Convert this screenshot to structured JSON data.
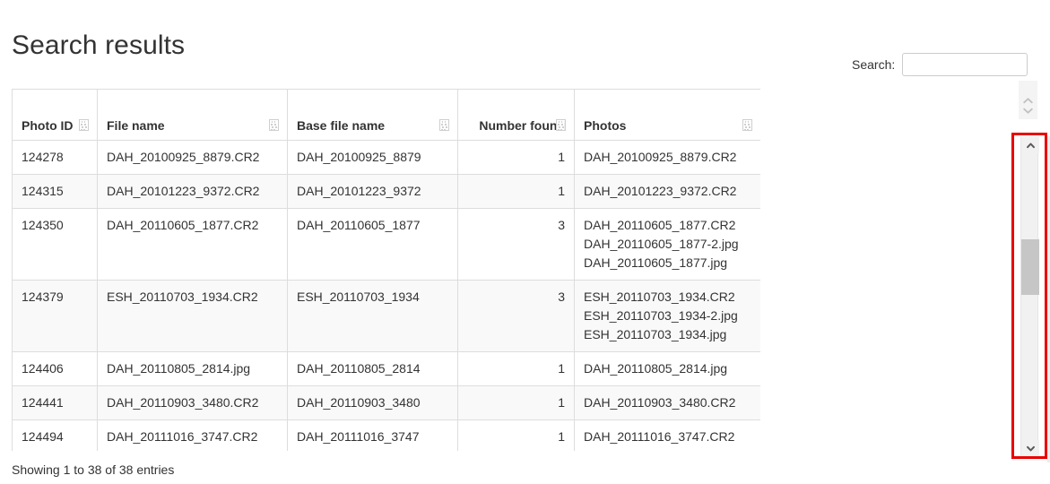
{
  "page": {
    "title": "Search results"
  },
  "search": {
    "label": "Search:",
    "value": "",
    "placeholder": ""
  },
  "table": {
    "columns": [
      {
        "label": "Photo ID",
        "align": "left",
        "sortable": true,
        "icon": "sort-icon"
      },
      {
        "label": "File name",
        "align": "left",
        "sortable": true,
        "icon": "sort-icon"
      },
      {
        "label": "Base file name",
        "align": "left",
        "sortable": true,
        "icon": "sort-icon"
      },
      {
        "label": "Number found",
        "align": "right",
        "sortable": true,
        "icon": "sort-icon"
      },
      {
        "label": "Photos",
        "align": "left",
        "sortable": true,
        "icon": "sort-icon"
      }
    ],
    "rows": [
      {
        "photo_id": "124278",
        "file_name": "DAH_20100925_8879.CR2",
        "base_file_name": "DAH_20100925_8879",
        "number_found": "1",
        "photos": [
          "DAH_20100925_8879.CR2"
        ]
      },
      {
        "photo_id": "124315",
        "file_name": "DAH_20101223_9372.CR2",
        "base_file_name": "DAH_20101223_9372",
        "number_found": "1",
        "photos": [
          "DAH_20101223_9372.CR2"
        ]
      },
      {
        "photo_id": "124350",
        "file_name": "DAH_20110605_1877.CR2",
        "base_file_name": "DAH_20110605_1877",
        "number_found": "3",
        "photos": [
          "DAH_20110605_1877.CR2",
          "DAH_20110605_1877-2.jpg",
          "DAH_20110605_1877.jpg"
        ]
      },
      {
        "photo_id": "124379",
        "file_name": "ESH_20110703_1934.CR2",
        "base_file_name": "ESH_20110703_1934",
        "number_found": "3",
        "photos": [
          "ESH_20110703_1934.CR2",
          "ESH_20110703_1934-2.jpg",
          "ESH_20110703_1934.jpg"
        ]
      },
      {
        "photo_id": "124406",
        "file_name": "DAH_20110805_2814.jpg",
        "base_file_name": "DAH_20110805_2814",
        "number_found": "1",
        "photos": [
          "DAH_20110805_2814.jpg"
        ]
      },
      {
        "photo_id": "124441",
        "file_name": "DAH_20110903_3480.CR2",
        "base_file_name": "DAH_20110903_3480",
        "number_found": "1",
        "photos": [
          "DAH_20110903_3480.CR2"
        ]
      },
      {
        "photo_id": "124494",
        "file_name": "DAH_20111016_3747.CR2",
        "base_file_name": "DAH_20111016_3747",
        "number_found": "1",
        "photos": [
          "DAH_20111016_3747.CR2"
        ]
      },
      {
        "photo_id": "",
        "file_name": "",
        "base_file_name": "",
        "number_found": "",
        "photos": [
          ""
        ]
      }
    ],
    "info": "Showing 1 to 38 of 38 entries"
  },
  "scrollbar": {
    "up_icon": "chevron-up-icon",
    "down_icon": "chevron-down-icon",
    "highlight_color": "#e80000",
    "thumb_color": "#c6c6c6",
    "track_color": "#f1f1f1"
  },
  "spinner": {
    "up_icon": "chevron-up-icon",
    "down_icon": "chevron-down-icon"
  }
}
